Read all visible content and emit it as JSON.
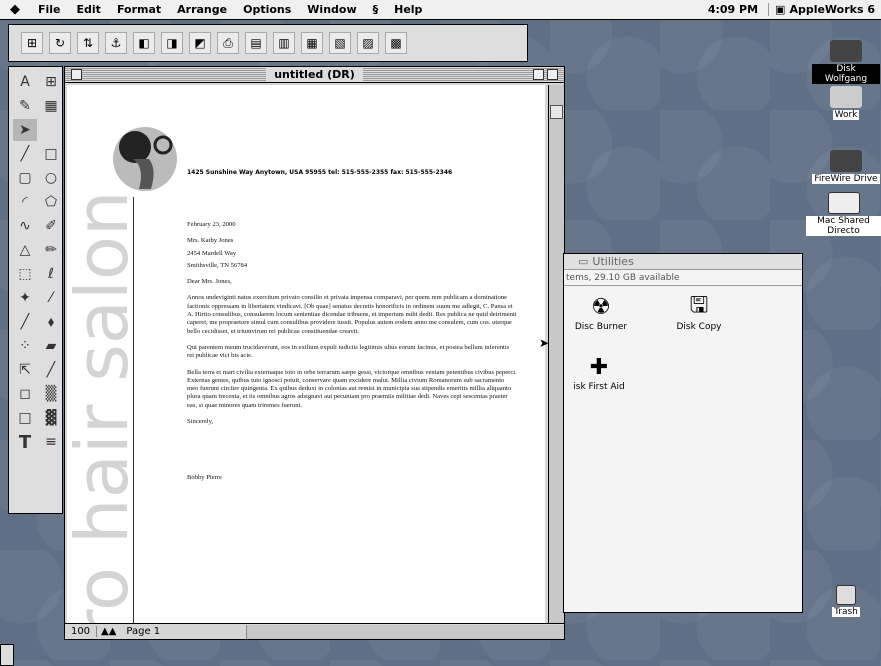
{
  "menubar": {
    "apple_icon": "apple-icon",
    "items": [
      "File",
      "Edit",
      "Format",
      "Arrange",
      "Options",
      "Window",
      "Help"
    ],
    "clock": "4:09 PM",
    "app_name": "AppleWorks 6"
  },
  "document": {
    "title": "untitled (DR)",
    "zoom": "100",
    "page_label": "Page 1",
    "vertical_brand": "ro hair salon",
    "address": "1425 Sunshine Way  Anytown, USA 95955   tel: 515-555-2355   fax: 515-555-2346",
    "date": "February 23, 2000",
    "recipient_name": "Mrs. Kathy Jones",
    "recipient_street": "2454 Mardell Way",
    "recipient_city": "Smithsville, TN  56784",
    "salutation": "Dear  Mrs. Jones,",
    "para1": "Annos undeviginti natus exercitum privato consilio et privata impensa comparavi, per quem rem publicam a dominatione factionis oppressam in libertatem vindicavi. [Ob quae] senatus decretis honorificis in ordinem suum me adlegit, C. Pansa et A. Hirtio consulibus, consularem locum  sententiae dicendae tribuens, et imperium mihi dedit. Res publica ne quid detrimenti caperet, me propraetore simul cum consulibus providere iussit. Populus autem eodem anno me consulem, cum cos. uterque bello cecidisset, et triumvirum rei publicae constituendae creavit.",
    "para2": "Qui parentem meum trucidaverunt, eos in exilium expuli iudiciis legitimis ultus eorum facinus, et postea bellum inferentis rei publicae vici bis acie.",
    "para3": "Bella terra et mari civilia externaque toto in orbe terrarum saepe gessi, victorque omnibus veniam petentibus civibus peperci. Externas gentes, quibus tuto ignosci potuit, conservare quam excidere malui. Millia civium Romanorum sub sacramento meo fuerunt circiter quingenta. Ex quibus deduxi in colonias aut remisi in municipia sua stipendis emeritis millia aliquanto plura quam trecenta, et iis omnibus agros adsignavi aut pecuniam pro praemiis militiae dedi. Naves cepi sescentas praeter eas, si quae minores quam triremes fuerunt.",
    "closing": "Sincerely,",
    "signature": "Bobby Pierre"
  },
  "utilities": {
    "title": "Utilities",
    "status": "tems, 29.10 GB available",
    "items": [
      {
        "label": "Disc Burner",
        "icon": "disc-burner-icon"
      },
      {
        "label": "Disk Copy",
        "icon": "disk-copy-icon"
      },
      {
        "label": "isk First Aid",
        "icon": "disk-first-aid-icon"
      }
    ]
  },
  "desktop": {
    "icons": [
      {
        "label": "Disk Wolfgang",
        "selected": true
      },
      {
        "label": "Work",
        "selected": false
      },
      {
        "label": "FireWire Drive",
        "selected": false
      },
      {
        "label": "Mac Shared Directo",
        "selected": false
      },
      {
        "label": "Trash",
        "selected": false
      }
    ]
  }
}
